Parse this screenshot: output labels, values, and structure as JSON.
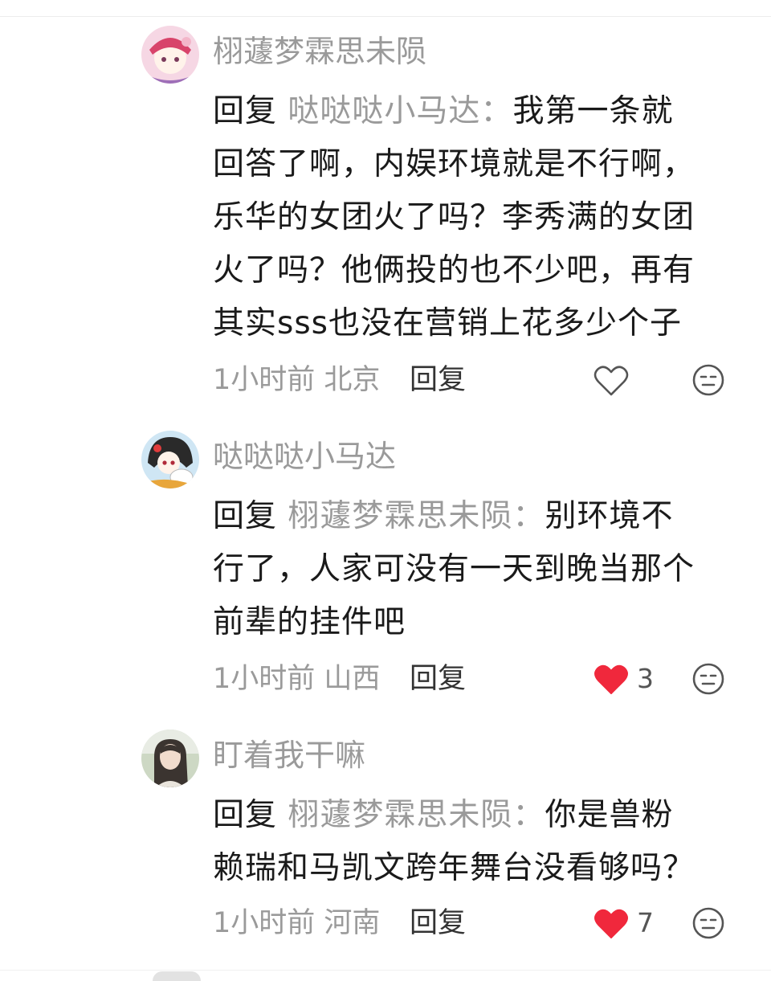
{
  "comments": [
    {
      "username": "栩蘧梦霖思未陨",
      "reply_prefix": "回复",
      "reply_target": "哒哒哒小马达：",
      "text_lines": [
        "我第一条就",
        "回答了啊，内娱环境就是不行啊，",
        "乐华的女团火了吗？李秀满的女团",
        "火了吗？他俩投的也不少吧，再有",
        "其实sss也没在营销上花多少个子"
      ],
      "time_location": "1小时前 北京",
      "reply_label": "回复",
      "liked": false,
      "like_count": "",
      "avatar_icon": "anime-girl-avatar-icon"
    },
    {
      "username": "哒哒哒小马达",
      "reply_prefix": "回复",
      "reply_target": "栩蘧梦霖思未陨：",
      "text_lines": [
        "别环境不",
        "行了，人家可没有一天到晚当那个",
        "前辈的挂件吧"
      ],
      "time_location": "1小时前 山西",
      "reply_label": "回复",
      "liked": true,
      "like_count": "3",
      "avatar_icon": "anime-girl-with-dog-avatar-icon"
    },
    {
      "username": "盯着我干嘛",
      "reply_prefix": "回复",
      "reply_target": "栩蘧梦霖思未陨：",
      "text_lines": [
        "你是兽粉",
        "赖瑞和马凯文跨年舞台没看够吗？"
      ],
      "time_location": "1小时前 河南",
      "reply_label": "回复",
      "liked": true,
      "like_count": "7",
      "avatar_icon": "photo-girl-avatar-icon"
    }
  ],
  "colors": {
    "name_gray": "#9a9a9a",
    "text_dark": "#1a1a1a",
    "like_red": "#f0283c",
    "icon_gray": "#555555"
  }
}
